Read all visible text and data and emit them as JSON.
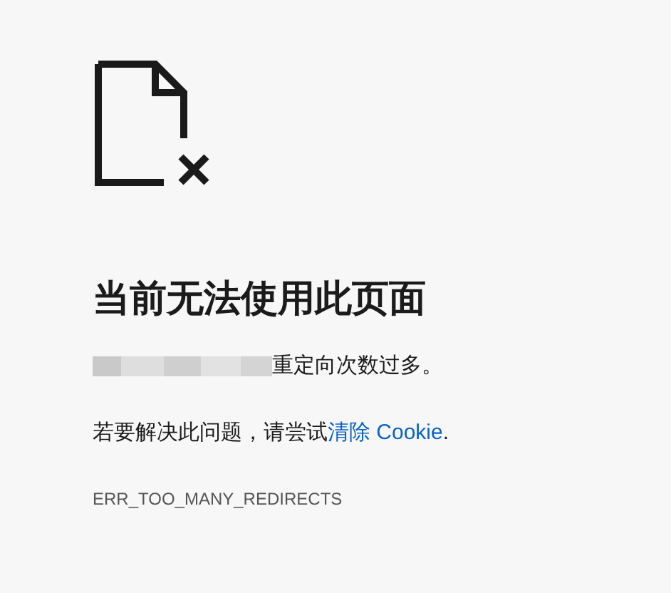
{
  "heading": "当前无法使用此页面",
  "message": {
    "after_redacted": "重定向次数过多。"
  },
  "suggestion": {
    "before": "若要解决此问题，请尝试",
    "link": "清除 Cookie",
    "after": "."
  },
  "error_code": "ERR_TOO_MANY_REDIRECTS"
}
